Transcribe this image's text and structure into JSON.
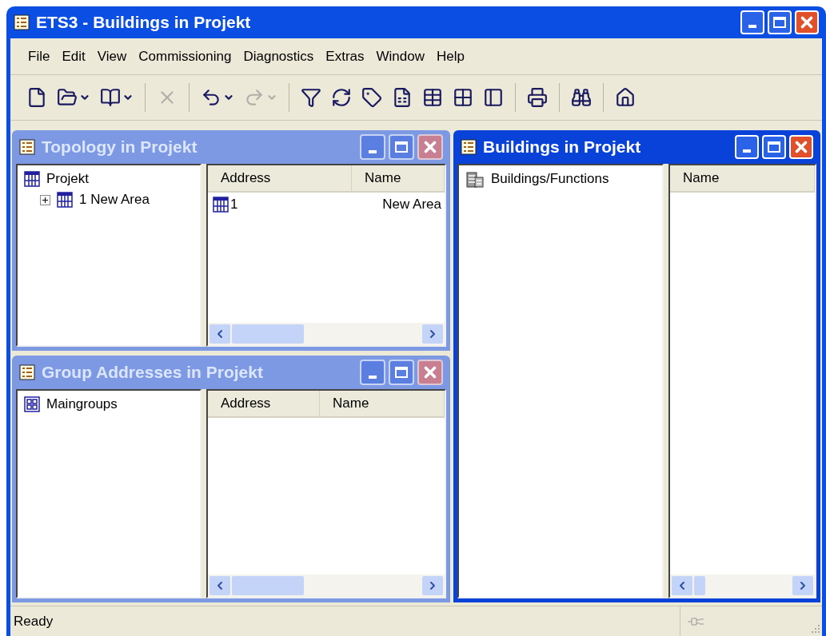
{
  "window": {
    "title": "ETS3 - Buildings in Projekt"
  },
  "menu": [
    "File",
    "Edit",
    "View",
    "Commissioning",
    "Diagnostics",
    "Extras",
    "Window",
    "Help"
  ],
  "toolbar": [
    [
      {
        "disabled": false,
        "has_menu": false
      },
      {
        "disabled": false,
        "has_menu": true
      },
      {
        "disabled": false,
        "has_menu": true
      }
    ],
    [
      {
        "disabled": true,
        "has_menu": false
      }
    ],
    [
      {
        "disabled": false,
        "has_menu": true
      },
      {
        "disabled": true,
        "has_menu": true
      }
    ],
    [
      {
        "disabled": false,
        "has_menu": false
      },
      {
        "disabled": false,
        "has_menu": false
      },
      {
        "disabled": false,
        "has_menu": false
      },
      {
        "disabled": false,
        "has_menu": false
      },
      {
        "disabled": false,
        "has_menu": false
      },
      {
        "disabled": false,
        "has_menu": false
      },
      {
        "disabled": false,
        "has_menu": false
      }
    ],
    [
      {
        "disabled": false,
        "has_menu": false
      }
    ],
    [
      {
        "disabled": false,
        "has_menu": false
      }
    ],
    [
      {
        "disabled": false,
        "has_menu": false
      }
    ]
  ],
  "child_windows": [
    {
      "title": "Topology in Projekt",
      "active": false,
      "tree": [
        {
          "kind": "area",
          "label": "Projekt",
          "children": [
            {
              "kind": "area",
              "label": "1 New Area",
              "expanded": false
            }
          ]
        }
      ],
      "columns": [
        "Address",
        "Name"
      ],
      "rows": [
        {
          "kind": "area",
          "cells": [
            "1",
            "New Area"
          ]
        }
      ]
    },
    {
      "title": "Group Addresses in Projekt",
      "active": false,
      "tree": [
        {
          "kind": "maingroups",
          "label": "Maingroups"
        }
      ],
      "columns": [
        "Address",
        "Name"
      ]
    },
    {
      "title": "Buildings in Projekt",
      "active": true,
      "tree": [
        {
          "kind": "buildings",
          "label": "Buildings/Functions"
        }
      ],
      "columns": [
        "Name"
      ]
    }
  ],
  "status_bar": {
    "text": "Ready"
  }
}
